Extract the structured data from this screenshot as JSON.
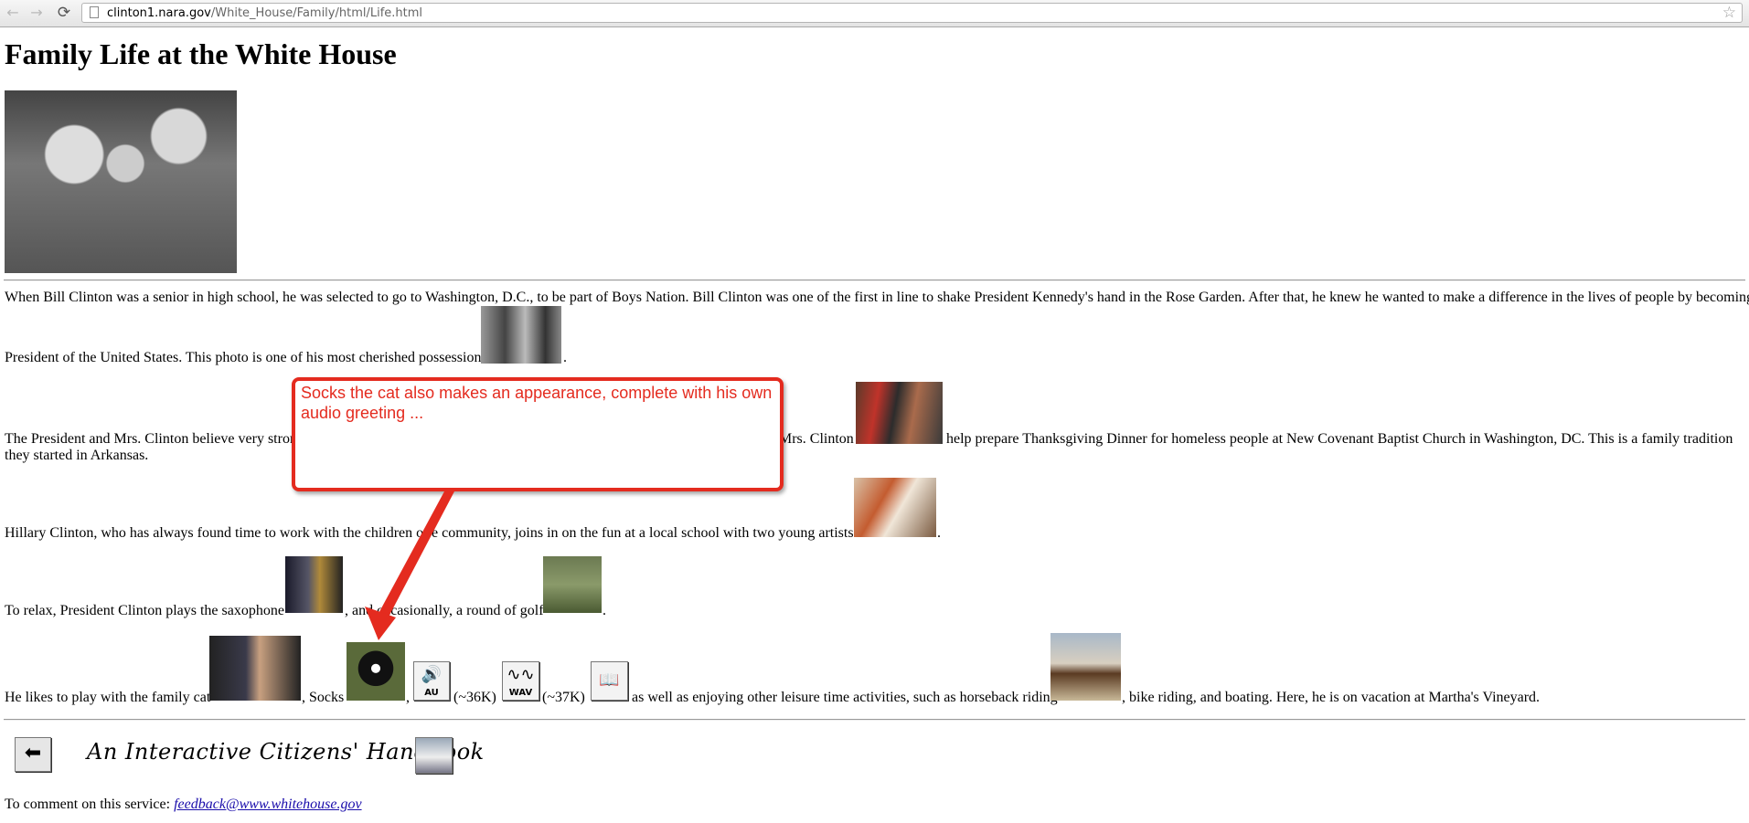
{
  "browser": {
    "url_host": "clinton1.nara.gov",
    "url_path": "/White_House/Family/html/Life.html",
    "back_glyph": "←",
    "forward_glyph": "→",
    "reload_glyph": "⟳",
    "star_glyph": "☆"
  },
  "page": {
    "title": "Family Life at the White House",
    "p1_line1": "When Bill Clinton was a senior in high school, he was selected to go to Washington, D.C., to be part of Boys Nation. Bill Clinton was one of the first in line to shake President Kennedy's hand in the Rose Garden. After that, he knew he wanted to make a difference in the lives of people by becoming",
    "p1_line2": "President of the United States. This photo is one of his most cherished possessions",
    "p1_end": ".",
    "p2_start": "The President and Mrs. Clinton believe very stron",
    "p2_mid": "Mrs. Clinton",
    "p2_rest": "help prepare Thanksgiving Dinner for homeless people at New Covenant Baptist Church in Washington, DC. This is a family tradition",
    "p2_line2": "they started in Arkansas.",
    "p3_start": "Hillary Clinton, who has always found time to work with the children of",
    "p3_mid": "e community, joins in on the fun at a local school with two young artists",
    "p3_end": ".",
    "p4_start": "To relax, President Clinton plays the saxophone",
    "p4_mid": ", and occasionally, a round of golf",
    "p4_end": ".",
    "p5_start": "He likes to play with the family cat",
    "p5_socks": ", Socks",
    "p5_comma": ",",
    "au_size": "(~36K)",
    "wav_size": "(~37K)",
    "p5_mid": "as well as enjoying other leisure time activities, such as horseback riding",
    "p5_end": ", bike riding, and boating. Here, he is on vacation at Martha's Vineyard.",
    "au_label": "AU",
    "wav_label": "WAV",
    "speaker_glyph": "🔊",
    "wave_glyph": "∿∿",
    "book_glyph": "📖",
    "back_arrow_glyph": "⬅",
    "handbook": "An Interactive Citizens' Handbook",
    "comment_label": "To comment on this service:",
    "feedback_email": "feedback@www.whitehouse.gov"
  },
  "callout": {
    "text": "Socks the cat also makes an appearance, complete with his own audio greeting ...",
    "color": "#e42b1f"
  },
  "icons": {
    "page": "document-icon",
    "star": "bookmark-star-icon",
    "speaker": "speaker-icon",
    "wave": "waveform-icon",
    "book": "open-book-icon",
    "home": "white-house-icon"
  }
}
